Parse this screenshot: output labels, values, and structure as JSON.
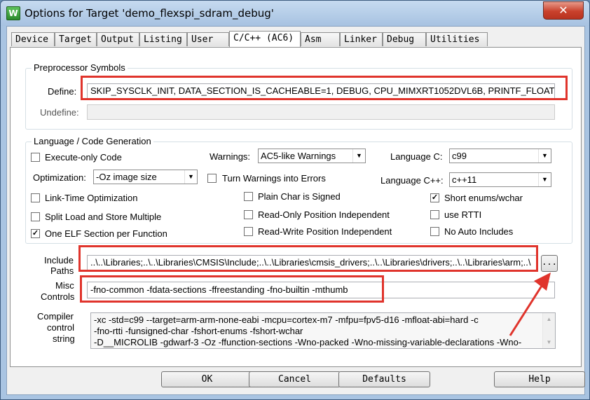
{
  "window": {
    "title": "Options for Target 'demo_flexspi_sdram_debug'",
    "icon": "uvision-icon",
    "close_label": "✕"
  },
  "tabs": [
    {
      "label": "Device"
    },
    {
      "label": "Target"
    },
    {
      "label": "Output"
    },
    {
      "label": "Listing"
    },
    {
      "label": "User"
    },
    {
      "label": "C/C++ (AC6)",
      "active": true
    },
    {
      "label": "Asm"
    },
    {
      "label": "Linker"
    },
    {
      "label": "Debug"
    },
    {
      "label": "Utilities"
    }
  ],
  "preprocessor": {
    "title": "Preprocessor Symbols",
    "define_label": "Define:",
    "define_value": "SKIP_SYSCLK_INIT, DATA_SECTION_IS_CACHEABLE=1, DEBUG, CPU_MIMXRT1052DVL6B, PRINTF_FLOAT_ENA",
    "undefine_label": "Undefine:",
    "undefine_value": ""
  },
  "language": {
    "title": "Language / Code Generation",
    "execute_only": {
      "label": "Execute-only Code",
      "checked": false
    },
    "warnings_label": "Warnings:",
    "warnings_value": "AC5-like Warnings",
    "language_c_label": "Language C:",
    "language_c_value": "c99",
    "optimization_label": "Optimization:",
    "optimization_value": "-Oz image size",
    "turn_warnings": {
      "label": "Turn Warnings into Errors",
      "checked": false
    },
    "language_cpp_label": "Language C++:",
    "language_cpp_value": "c++11",
    "lto": {
      "label": "Link-Time Optimization",
      "checked": false
    },
    "plain_char": {
      "label": "Plain Char is Signed",
      "checked": false
    },
    "short_enums": {
      "label": "Short enums/wchar",
      "checked": true
    },
    "split_load": {
      "label": "Split Load and Store Multiple",
      "checked": false
    },
    "ropi": {
      "label": "Read-Only Position Independent",
      "checked": false
    },
    "use_rtti": {
      "label": "use RTTI",
      "checked": false
    },
    "one_elf": {
      "label": "One ELF Section per Function",
      "checked": true
    },
    "rwpi": {
      "label": "Read-Write Position Independent",
      "checked": false
    },
    "no_auto_includes": {
      "label": "No Auto Includes",
      "checked": false
    }
  },
  "include": {
    "label_line1": "Include",
    "label_line2": "Paths",
    "value": "..\\..\\Libraries;..\\..\\Libraries\\CMSIS\\Include;..\\..\\Libraries\\cmsis_drivers;..\\..\\Libraries\\drivers;..\\..\\Libraries\\arm;..\\",
    "browse_label": "..."
  },
  "misc": {
    "label_line1": "Misc",
    "label_line2": "Controls",
    "value": "-fno-common  -fdata-sections  -ffreestanding  -fno-builtin  -mthumb"
  },
  "compiler": {
    "label_line1": "Compiler",
    "label_line2": "control",
    "label_line3": "string",
    "lines": [
      "-xc -std=c99 --target=arm-arm-none-eabi -mcpu=cortex-m7 -mfpu=fpv5-d16 -mfloat-abi=hard -c",
      "-fno-rtti -funsigned-char -fshort-enums -fshort-wchar",
      "-D__MICROLIB -gdwarf-3 -Oz -ffunction-sections -Wno-packed -Wno-missing-variable-declarations -Wno-"
    ]
  },
  "buttons": {
    "ok": "OK",
    "cancel": "Cancel",
    "defaults": "Defaults",
    "help": "Help"
  },
  "annotation": {
    "color": "#e0342c"
  }
}
